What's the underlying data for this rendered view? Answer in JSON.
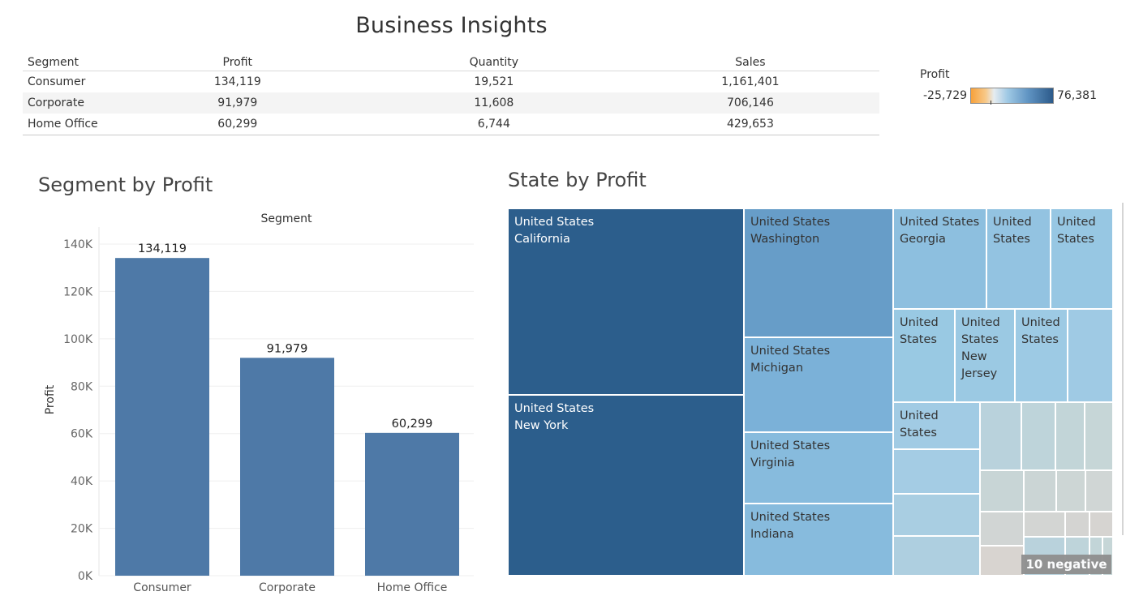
{
  "dashboard": {
    "title": "Business Insights"
  },
  "summary_table": {
    "headers": [
      "Segment",
      "Profit",
      "Quantity",
      "Sales"
    ],
    "rows": [
      [
        "Consumer",
        "134,119",
        "19,521",
        "1,161,401"
      ],
      [
        "Corporate",
        "91,979",
        "11,608",
        "706,146"
      ],
      [
        "Home Office",
        "60,299",
        "6,744",
        "429,653"
      ]
    ]
  },
  "legend": {
    "title": "Profit",
    "min_label": "-25,729",
    "max_label": "76,381",
    "low_color": "#f7a13a",
    "high_color": "#2c5a8a"
  },
  "chart_data": [
    {
      "type": "bar",
      "title": "Segment by Profit",
      "header": "Segment",
      "categories": [
        "Consumer",
        "Corporate",
        "Home Office"
      ],
      "values": [
        134119,
        91979,
        60299
      ],
      "value_labels": [
        "134,119",
        "91,979",
        "60,299"
      ],
      "ylabel": "Profit",
      "ylim": [
        0,
        140000
      ],
      "yticks": [
        0,
        20000,
        40000,
        60000,
        80000,
        100000,
        120000,
        140000
      ],
      "ytick_labels": [
        "0K",
        "20K",
        "40K",
        "60K",
        "80K",
        "100K",
        "120K",
        "140K"
      ],
      "bar_color": "#4e79a7",
      "grid": true
    },
    {
      "type": "treemap",
      "title": "State by Profit",
      "cells": [
        {
          "label": [
            "United States",
            "California"
          ],
          "color": "#2c5e8c"
        },
        {
          "label": [
            "United States",
            "New York"
          ],
          "color": "#2c5e8c"
        },
        {
          "label": [
            "United States",
            "Washington"
          ],
          "color": "#679dc8"
        },
        {
          "label": [
            "United States",
            "Michigan"
          ],
          "color": "#7bb1d8"
        },
        {
          "label": [
            "United States",
            "Virginia"
          ],
          "color": "#87bbdd"
        },
        {
          "label": [
            "United States",
            "Indiana"
          ],
          "color": "#87bbdd"
        },
        {
          "label": [
            "United States",
            "Georgia"
          ],
          "color": "#8dbfdf"
        },
        {
          "label": [
            "United",
            "States"
          ],
          "color": "#93c3e1"
        },
        {
          "label": [
            "United",
            "States"
          ],
          "color": "#97c7e3"
        },
        {
          "label": [
            "United",
            "States"
          ],
          "color": "#99c9e3"
        },
        {
          "label": [
            "United",
            "States",
            "New",
            "Jersey"
          ],
          "color": "#9bc9e3"
        },
        {
          "label": [
            "United",
            "States"
          ],
          "color": "#9dcae4"
        },
        {
          "label": [],
          "color": "#9fcae4"
        },
        {
          "label": [
            "United",
            "States"
          ],
          "color": "#a1cbe4"
        },
        {
          "label": [],
          "color": "#a4cce4"
        },
        {
          "label": [],
          "color": "#a9cee2"
        },
        {
          "label": [],
          "color": "#aecfe0"
        }
      ],
      "small_cell_colors": [
        "#b9d2dc",
        "#bed4da",
        "#c2d5d8",
        "#c6d6d7",
        "#c8d5d6",
        "#cbd5d5",
        "#cdd6d5",
        "#d0d6d5",
        "#d1d5d4",
        "#d3d5d3",
        "#d4d4d2",
        "#d6d4d1",
        "#d8d4d0"
      ],
      "badge": "10 negative"
    }
  ]
}
